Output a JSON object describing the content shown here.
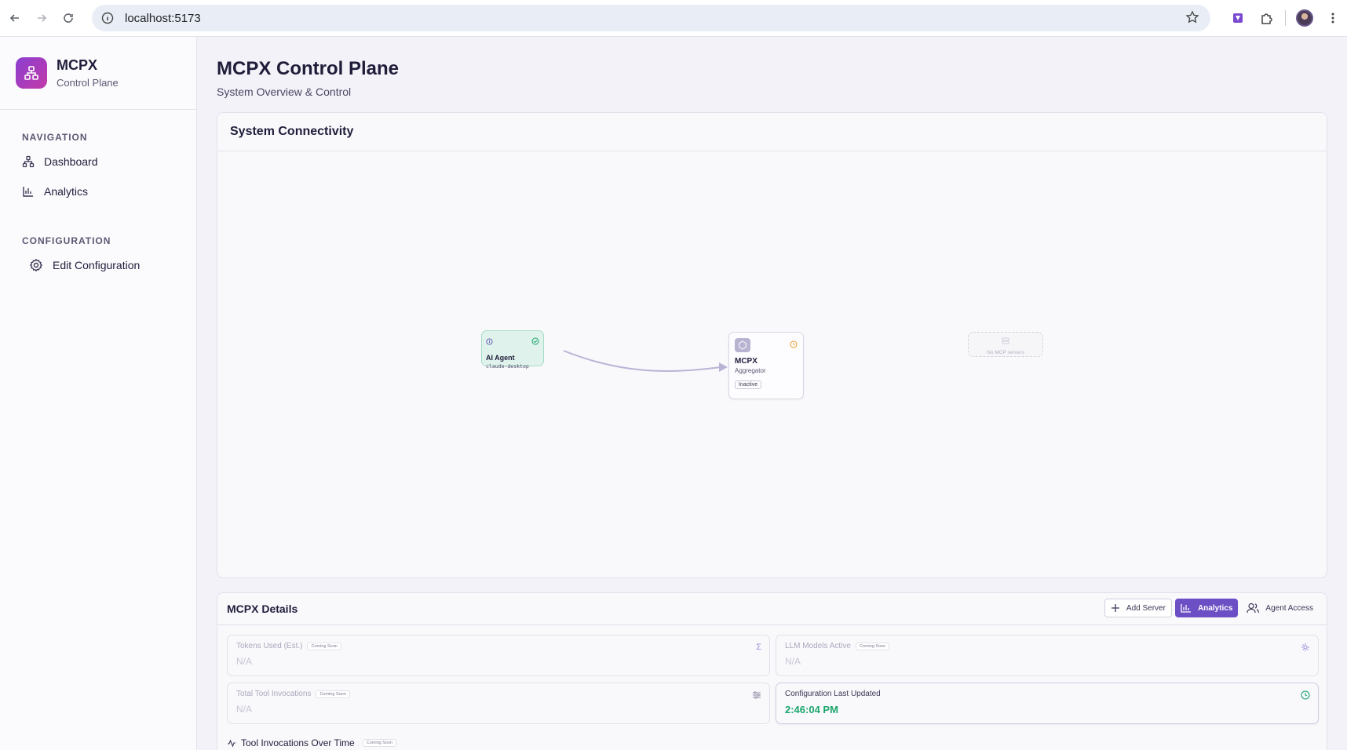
{
  "browser": {
    "url": "localhost:5173"
  },
  "sidebar": {
    "brand_title": "MCPX",
    "brand_subtitle": "Control Plane",
    "navigation_label": "NAVIGATION",
    "nav_items": [
      {
        "label": "Dashboard",
        "icon": "network-icon"
      },
      {
        "label": "Analytics",
        "icon": "bar-chart-icon"
      }
    ],
    "configuration_label": "CONFIGURATION",
    "config_items": [
      {
        "label": "Edit Configuration",
        "icon": "gear-icon"
      }
    ]
  },
  "header": {
    "title": "MCPX Control Plane",
    "subtitle": "System Overview & Control"
  },
  "connectivity": {
    "title": "System Connectivity",
    "agent": {
      "title": "AI Agent",
      "client": "claude-desktop",
      "status_color": "#1aa56b"
    },
    "mcpx": {
      "title": "MCPX",
      "subtitle": "Aggregator",
      "status": "Inactive",
      "status_color": "#f0a030"
    },
    "servers_placeholder": "No MCP servers"
  },
  "details": {
    "title": "MCPX Details",
    "actions": {
      "add_server": "Add Server",
      "analytics": "Analytics",
      "agent_access": "Agent Access"
    },
    "stats": {
      "tokens": {
        "label": "Tokens Used (Est.)",
        "badge": "Coming Soon",
        "value": "N/A",
        "icon": "sigma-icon"
      },
      "llm_models": {
        "label": "LLM Models Active",
        "badge": "Coming Soon",
        "value": "N/A",
        "icon": "brain-icon"
      },
      "tool_invocations": {
        "label": "Total Tool Invocations",
        "badge": "Coming Soon",
        "value": "N/A",
        "icon": "sliders-icon"
      },
      "config_updated": {
        "label": "Configuration Last Updated",
        "value": "2:46:04 PM",
        "icon": "clock-icon"
      }
    },
    "chart": {
      "title": "Tool Invocations Over Time",
      "badge": "Coming Soon"
    }
  },
  "colors": {
    "accent": "#6c4fc4",
    "success": "#1aa56b",
    "warning": "#f0a030"
  }
}
